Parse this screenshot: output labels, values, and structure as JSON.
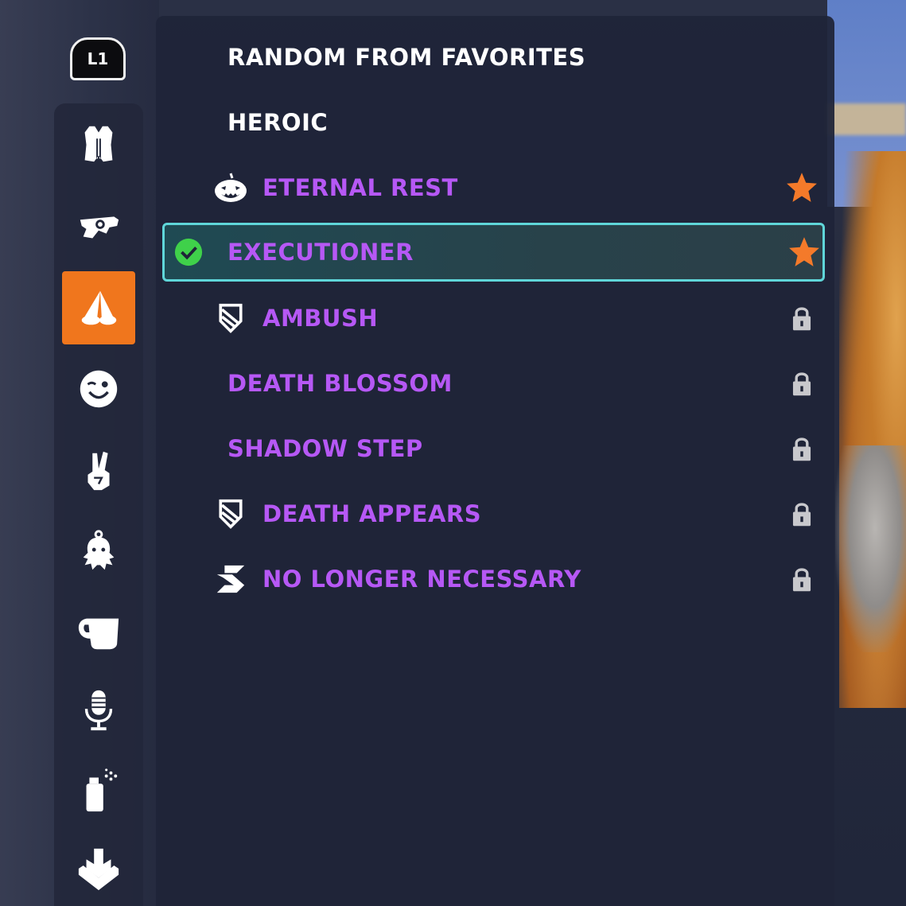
{
  "controller_hint": {
    "label": "L1"
  },
  "sidebar": {
    "items": [
      {
        "name": "skins",
        "icon": "vest-icon",
        "active": false
      },
      {
        "name": "weapons",
        "icon": "weapon-charm-icon",
        "active": false
      },
      {
        "name": "emotes",
        "icon": "emote-icon",
        "active": true
      },
      {
        "name": "sprays-wink",
        "icon": "wink-face-icon",
        "active": false
      },
      {
        "name": "victory-poses",
        "icon": "peace-hand-icon",
        "active": false
      },
      {
        "name": "souvenirs",
        "icon": "octopus-charm-icon",
        "active": false
      },
      {
        "name": "highlight-intros",
        "icon": "mug-icon",
        "active": false
      },
      {
        "name": "voice-lines",
        "icon": "microphone-icon",
        "active": false
      },
      {
        "name": "sprays",
        "icon": "spray-can-icon",
        "active": false
      },
      {
        "name": "highlight",
        "icon": "arrow-down-icon",
        "active": false
      }
    ],
    "accent_color": "#f0761d"
  },
  "list": {
    "items": [
      {
        "label": "RANDOM FROM FAVORITES",
        "color": "white",
        "left_icon": null,
        "right_icon": null,
        "selected": false
      },
      {
        "label": "HEROIC",
        "color": "white",
        "left_icon": null,
        "right_icon": null,
        "selected": false
      },
      {
        "label": "ETERNAL REST",
        "color": "purple",
        "left_icon": "pumpkin-icon",
        "right_icon": "favorite-star-icon",
        "selected": false
      },
      {
        "label": "EXECUTIONER",
        "color": "purple",
        "left_icon": "equipped-check-icon",
        "right_icon": "favorite-star-icon",
        "selected": true
      },
      {
        "label": "AMBUSH",
        "color": "purple",
        "left_icon": "shield-event-icon",
        "right_icon": "lock-icon",
        "selected": false
      },
      {
        "label": "DEATH BLOSSOM",
        "color": "purple",
        "left_icon": null,
        "right_icon": "lock-icon",
        "selected": false
      },
      {
        "label": "SHADOW STEP",
        "color": "purple",
        "left_icon": null,
        "right_icon": "lock-icon",
        "selected": false
      },
      {
        "label": "DEATH APPEARS",
        "color": "purple",
        "left_icon": "shield-event-icon",
        "right_icon": "lock-icon",
        "selected": false
      },
      {
        "label": "NO LONGER NECESSARY",
        "color": "purple",
        "left_icon": "season-s-icon",
        "right_icon": "lock-icon",
        "selected": false
      }
    ],
    "colors": {
      "purple": "#b658f5",
      "white": "#ffffff",
      "star": "#f47a2a",
      "check": "#3fd14a",
      "selection_border": "#5fd6d9"
    }
  }
}
